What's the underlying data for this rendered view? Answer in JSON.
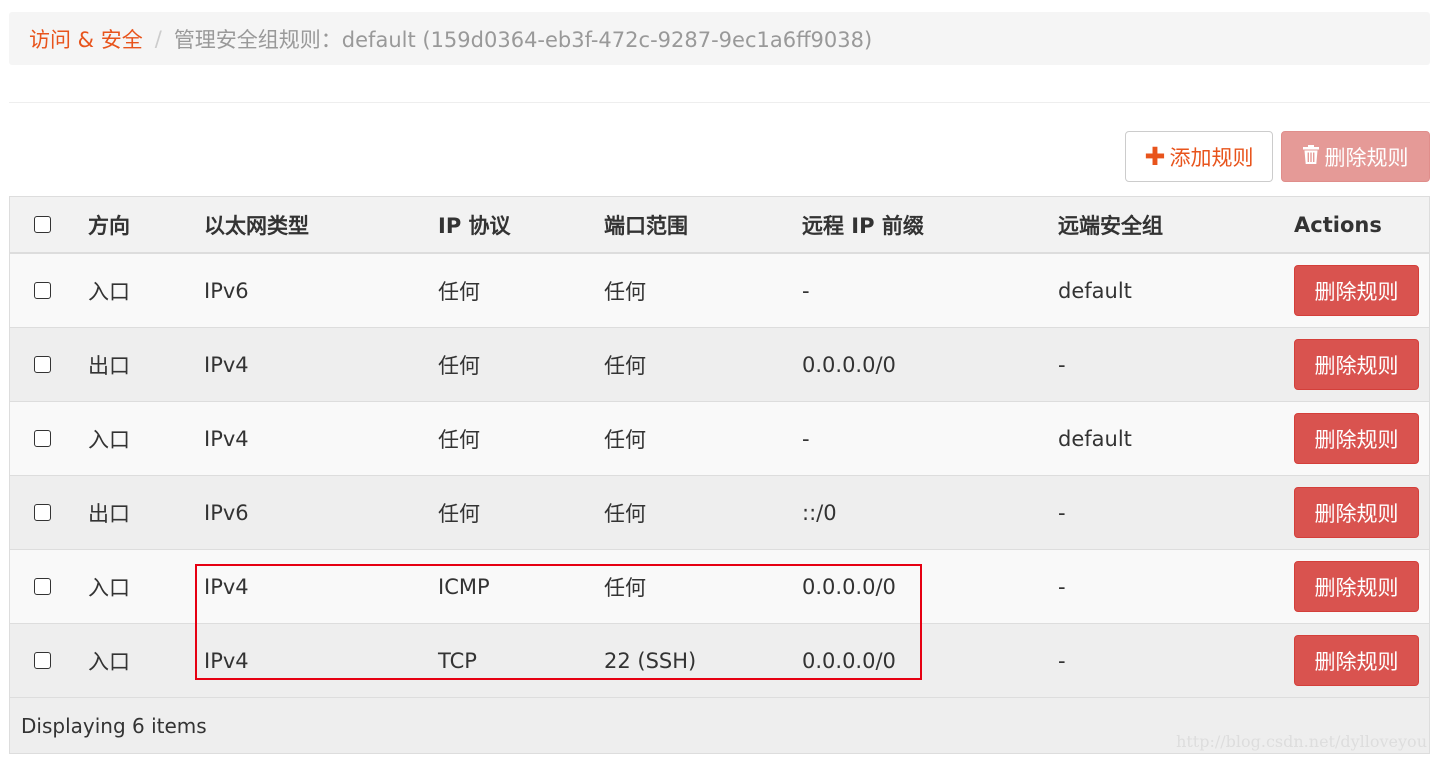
{
  "breadcrumb": {
    "parent": "访问 & 安全",
    "separator": "/",
    "current": "管理安全组规则：default (159d0364-eb3f-472c-9287-9ec1a6ff9038)"
  },
  "toolbar": {
    "add_label": "添加规则",
    "add_icon": "plus-icon",
    "delete_label": "删除规则",
    "delete_icon": "trash-icon"
  },
  "table": {
    "headers": {
      "direction": "方向",
      "ethertype": "以太网类型",
      "ip_protocol": "IP 协议",
      "port_range": "端口范围",
      "remote_ip_prefix": "远程 IP 前缀",
      "remote_security_group": "远端安全组",
      "actions": "Actions"
    },
    "rows": [
      {
        "direction": "入口",
        "ethertype": "IPv6",
        "ip_protocol": "任何",
        "port_range": "任何",
        "remote_ip_prefix": "-",
        "remote_security_group": "default",
        "action_label": "删除规则"
      },
      {
        "direction": "出口",
        "ethertype": "IPv4",
        "ip_protocol": "任何",
        "port_range": "任何",
        "remote_ip_prefix": "0.0.0.0/0",
        "remote_security_group": "-",
        "action_label": "删除规则"
      },
      {
        "direction": "入口",
        "ethertype": "IPv4",
        "ip_protocol": "任何",
        "port_range": "任何",
        "remote_ip_prefix": "-",
        "remote_security_group": "default",
        "action_label": "删除规则"
      },
      {
        "direction": "出口",
        "ethertype": "IPv6",
        "ip_protocol": "任何",
        "port_range": "任何",
        "remote_ip_prefix": "::/0",
        "remote_security_group": "-",
        "action_label": "删除规则"
      },
      {
        "direction": "入口",
        "ethertype": "IPv4",
        "ip_protocol": "ICMP",
        "port_range": "任何",
        "remote_ip_prefix": "0.0.0.0/0",
        "remote_security_group": "-",
        "action_label": "删除规则"
      },
      {
        "direction": "入口",
        "ethertype": "IPv4",
        "ip_protocol": "TCP",
        "port_range": "22 (SSH)",
        "remote_ip_prefix": "0.0.0.0/0",
        "remote_security_group": "-",
        "action_label": "删除规则"
      }
    ],
    "footer": "Displaying 6 items"
  },
  "colors": {
    "accent": "#e8541c",
    "danger": "#d9534f",
    "danger_disabled": "#e59a97",
    "highlight_box": "#e60012"
  },
  "watermark": "http://blog.csdn.net/dylloveyou"
}
